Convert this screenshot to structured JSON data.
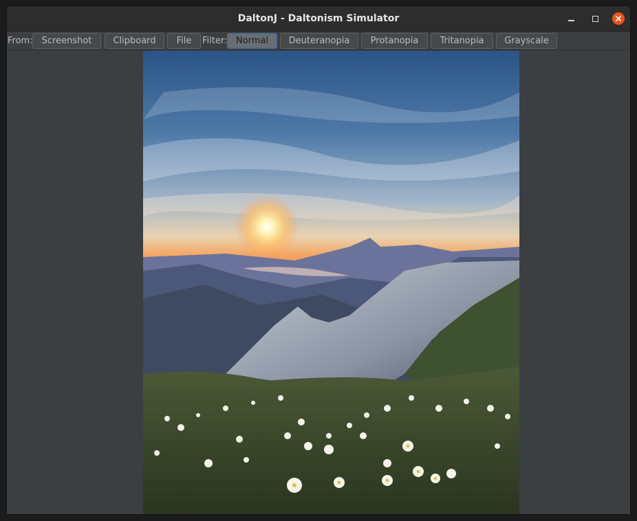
{
  "window": {
    "title": "DaltonJ - Daltonism Simulator"
  },
  "toolbar": {
    "from_label": "From:",
    "source_buttons": [
      "Screenshot",
      "Clipboard",
      "File"
    ],
    "filter_label": "Filter:",
    "filter_buttons": [
      "Normal",
      "Deuteranopia",
      "Protanopia",
      "Tritanopia",
      "Grayscale"
    ],
    "active_filter": "Normal"
  },
  "viewer": {
    "image_subject": "mountain sunset landscape with white alpine flowers"
  },
  "colors": {
    "window_bg": "#3c3f41",
    "titlebar_bg": "#2d2d2d",
    "close_button": "#e95420",
    "active_filter_border": "#4a6e92"
  },
  "icons": [
    "minimize-icon",
    "maximize-icon",
    "close-icon"
  ]
}
